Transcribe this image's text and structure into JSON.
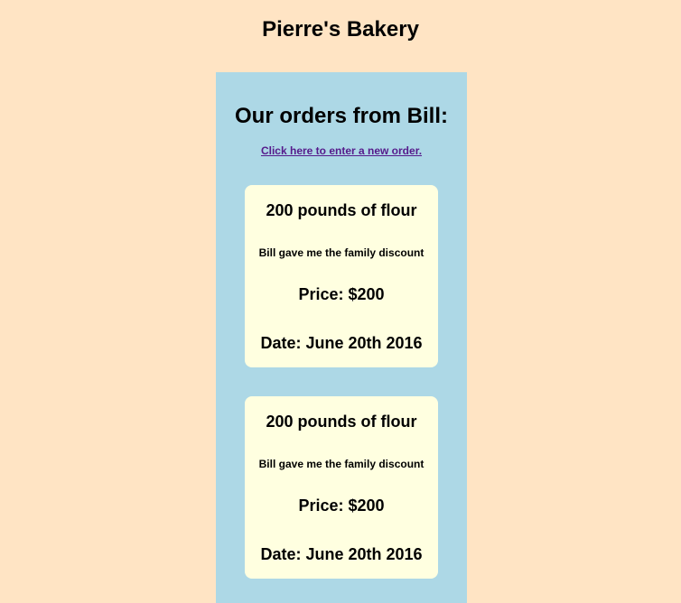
{
  "site": {
    "title": "Pierre's Bakery"
  },
  "vendor_page": {
    "heading": "Our orders from Bill:",
    "new_order_link": "Click here to enter a new order."
  },
  "orders": [
    {
      "product": "200 pounds of flour",
      "note": "Bill gave me the family discount",
      "price": "Price: $200",
      "date": "Date: June 20th 2016"
    },
    {
      "product": "200 pounds of flour",
      "note": "Bill gave me the family discount",
      "price": "Price: $200",
      "date": "Date: June 20th 2016"
    }
  ],
  "colors": {
    "page_background": "#ffe4c4",
    "panel_background": "#add8e6",
    "card_background": "#ffffe0",
    "link": "#551a8b"
  }
}
